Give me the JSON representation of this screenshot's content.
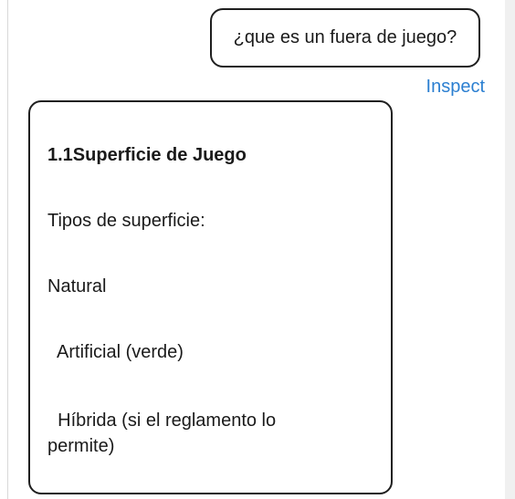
{
  "conversation": {
    "user_message": "¿que es un fuera de juego?",
    "inspect_label": "Inspect",
    "bot_message": {
      "heading": "1.1Superficie de Juego",
      "line_1": "Tipos de superficie:",
      "line_2": "Natural",
      "line_3": "  Artificial (verde)",
      "line_4": "  Híbrida (si el reglamento lo permite)"
    }
  },
  "colors": {
    "bubble_border": "#1f1f1f",
    "link": "#2b7fd1",
    "text": "#1a1a1a"
  }
}
